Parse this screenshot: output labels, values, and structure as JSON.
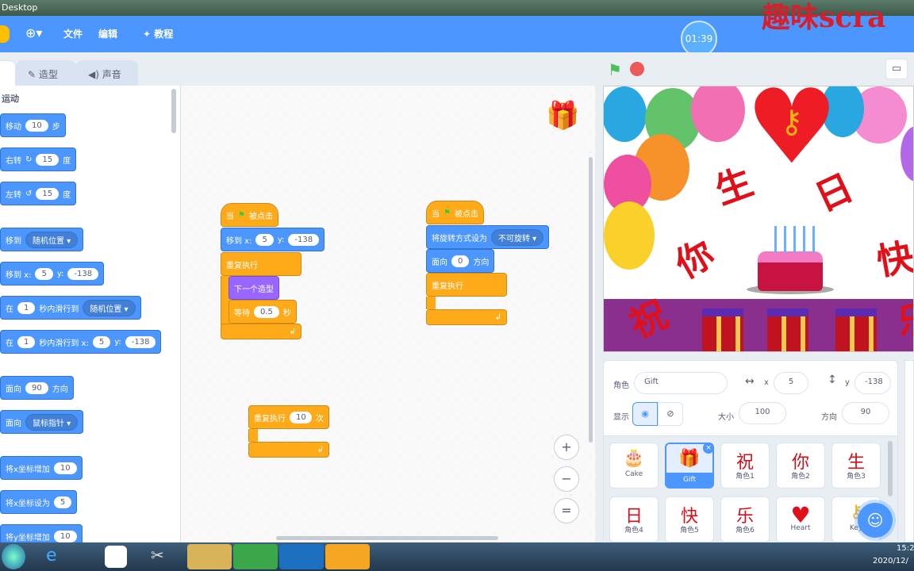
{
  "window": {
    "title": "Desktop"
  },
  "watermark": "趣味scra",
  "menubar": {
    "file": "文件",
    "edit": "编辑",
    "tutorials": "教程",
    "timer": "01:39"
  },
  "tabs": [
    {
      "label": ""
    },
    {
      "label": "造型"
    },
    {
      "label": "声音"
    }
  ],
  "palette": {
    "category": "运动",
    "blocks": [
      {
        "text": "移动",
        "v1": "10",
        "t2": "步"
      },
      {
        "text": "右转",
        "v1": "15",
        "t2": "度"
      },
      {
        "text": "左转",
        "v1": "15",
        "t2": "度"
      },
      {
        "text": "移到",
        "d1": "随机位置"
      },
      {
        "text": "移到 x:",
        "v1": "5",
        "t2": "y:",
        "v2": "-138"
      },
      {
        "text": "在",
        "v1": "1",
        "t2": "秒内滑行到",
        "d1": "随机位置"
      },
      {
        "text": "在",
        "v1": "1",
        "t2": "秒内滑行到 x:",
        "v2": "5",
        "t3": "y:",
        "v3": "-138"
      },
      {
        "text": "面向",
        "v1": "90",
        "t2": "方向"
      },
      {
        "text": "面向",
        "d1": "鼠标指针"
      },
      {
        "text": "将x坐标增加",
        "v1": "10"
      },
      {
        "text": "将x坐标设为",
        "v1": "5"
      },
      {
        "text": "将y坐标增加",
        "v1": "10"
      }
    ]
  },
  "code": {
    "script1": {
      "hat": "当",
      "hat2": "被点击",
      "goto": "移到 x:",
      "gx": "5",
      "gy_label": "y:",
      "gy": "-138",
      "forever": "重复执行",
      "next": "下一个造型",
      "wait": "等待",
      "wait_v": "0.5",
      "wait_u": "秒"
    },
    "script2": {
      "hat": "当",
      "hat2": "被点击",
      "rot": "将旋转方式设为",
      "rot_v": "不可旋转",
      "point": "面向",
      "point_v": "0",
      "point_u": "方向",
      "forever": "重复执行"
    },
    "script3": {
      "repeat": "重复执行",
      "repeat_v": "10",
      "repeat_u": "次"
    },
    "zoom_in": "+",
    "zoom_out": "−",
    "zoom_reset": "="
  },
  "stage": {
    "chars": [
      "祝",
      "你",
      "生",
      "日",
      "快",
      "乐"
    ]
  },
  "sprite_info": {
    "sprite_label": "角色",
    "sprite_name": "Gift",
    "x_label": "x",
    "x": "5",
    "y_label": "y",
    "y": "-138",
    "show_label": "显示",
    "size_label": "大小",
    "size": "100",
    "dir_label": "方向",
    "dir": "90"
  },
  "sprites": [
    {
      "glyph": "🎂",
      "name": "Cake"
    },
    {
      "glyph": "🎁",
      "name": "Gift"
    },
    {
      "glyph": "祝",
      "name": "角色1"
    },
    {
      "glyph": "你",
      "name": "角色2"
    },
    {
      "glyph": "生",
      "name": "角色3"
    },
    {
      "glyph": "日",
      "name": "角色4"
    },
    {
      "glyph": "快",
      "name": "角色5"
    },
    {
      "glyph": "乐",
      "name": "角色6"
    },
    {
      "glyph": "♥",
      "name": "Heart"
    },
    {
      "glyph": "",
      "name": "Key"
    }
  ],
  "taskbar": {
    "time": "15:2",
    "date": "2020/12/"
  }
}
